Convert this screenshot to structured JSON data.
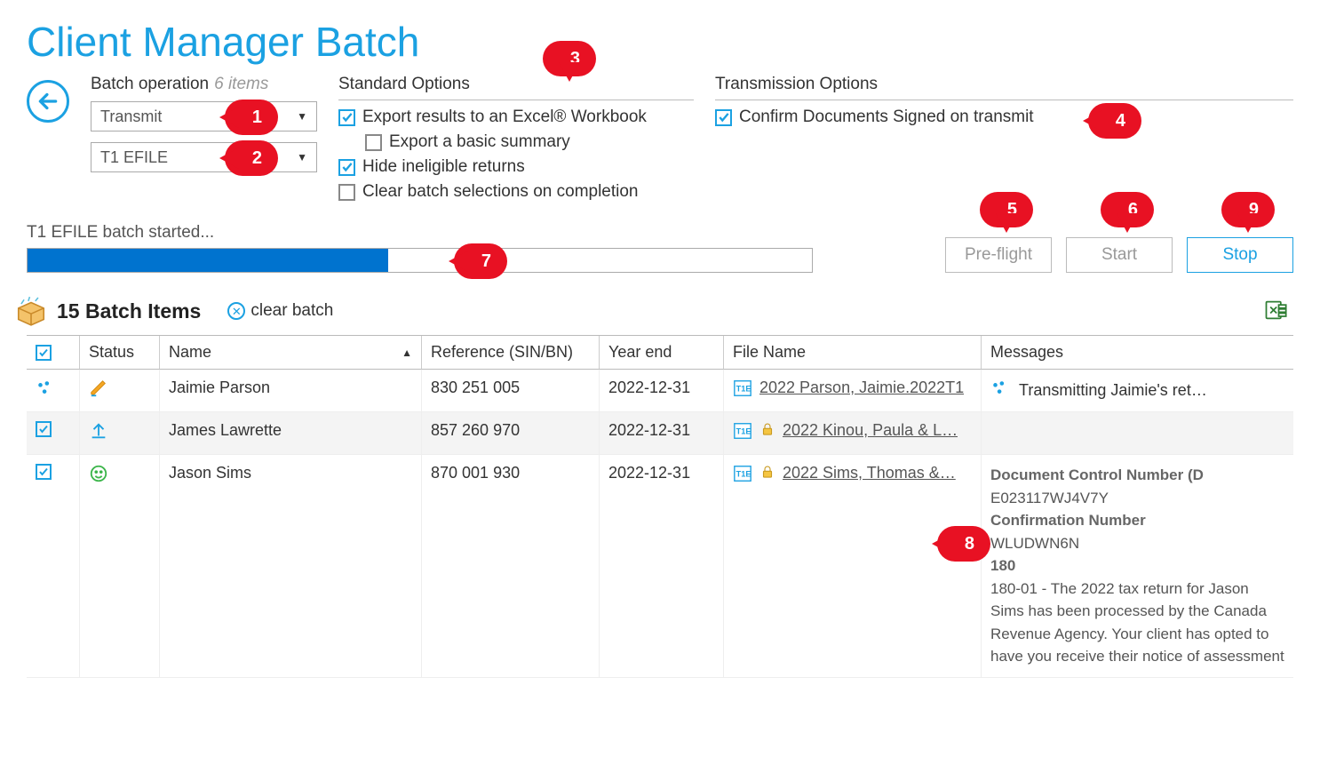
{
  "title": "Client Manager Batch",
  "batch_operation": {
    "label": "Batch operation",
    "count_text": "6 items",
    "dropdown1": "Transmit",
    "dropdown2": "T1 EFILE"
  },
  "standard_options": {
    "label": "Standard Options",
    "opt_export_excel": {
      "text": "Export results to an Excel® Workbook",
      "checked": true
    },
    "opt_export_basic": {
      "text": "Export a basic summary",
      "checked": false
    },
    "opt_hide_ineligible": {
      "text": "Hide ineligible returns",
      "checked": true
    },
    "opt_clear_on_complete": {
      "text": "Clear batch selections on completion",
      "checked": false
    }
  },
  "transmission_options": {
    "label": "Transmission Options",
    "opt_confirm_signed": {
      "text": "Confirm Documents Signed on transmit",
      "checked": true
    }
  },
  "progress": {
    "label": "T1 EFILE batch started...",
    "percent": 46
  },
  "buttons": {
    "preflight": "Pre-flight",
    "start": "Start",
    "stop": "Stop"
  },
  "batch_items": {
    "title": "15 Batch Items",
    "clear_label": "clear batch"
  },
  "columns": {
    "check": "",
    "status": "Status",
    "name": "Name",
    "reference": "Reference (SIN/BN)",
    "yearend": "Year end",
    "filename": "File Name",
    "messages": "Messages"
  },
  "rows": [
    {
      "checked": false,
      "status": "editing",
      "name": "Jaimie Parson",
      "reference": "830 251 005",
      "yearend": "2022-12-31",
      "locked": false,
      "filename": "2022 Parson, Jaimie.2022T1",
      "message_type": "transmitting",
      "message_text": "Transmitting Jaimie's ret…"
    },
    {
      "checked": true,
      "status": "upload",
      "name": "James Lawrette",
      "reference": "857 260 970",
      "yearend": "2022-12-31",
      "locked": true,
      "filename": "2022 Kinou, Paula & L…",
      "message_type": "none",
      "message_text": ""
    },
    {
      "checked": true,
      "status": "ok",
      "name": "Jason Sims",
      "reference": "870 001 930",
      "yearend": "2022-12-31",
      "locked": true,
      "filename": "2022 Sims, Thomas &…",
      "message_type": "details",
      "message_details": {
        "dcn_label": "Document Control Number (D",
        "dcn_value": "E023117WJ4V7Y",
        "conf_label": "Confirmation Number",
        "conf_value": "WLUDWN6N",
        "code": "180",
        "body": "180-01 - The 2022 tax return for Jason Sims has been processed by the Canada Revenue Agency. Your client has opted to have you receive their notice of assessment"
      }
    }
  ],
  "callouts": {
    "c1": "1",
    "c2": "2",
    "c3": "3",
    "c4": "4",
    "c5": "5",
    "c6": "6",
    "c7": "7",
    "c8": "8",
    "c9": "9"
  }
}
